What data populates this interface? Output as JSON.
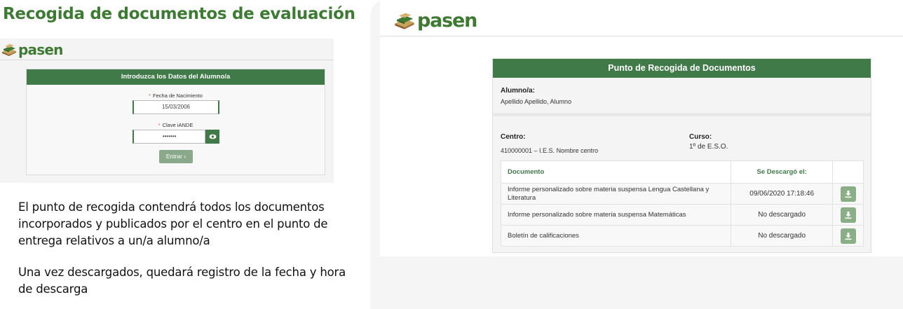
{
  "slide_title": "Recogida de documentos de evaluación",
  "brand": {
    "name": "pasen",
    "color": "#3f7a33",
    "accent": "#3f7a48"
  },
  "login_form": {
    "header": "Introduzca los Datos del Alumno/a",
    "birthdate_label": "Fecha de Nacimiento",
    "birthdate_value": "15/03/2006",
    "key_label": "Clave iANDE",
    "key_value": "•••••••",
    "submit_label": "Entrar ›",
    "required_mark": "*"
  },
  "paragraphs": [
    "El punto de recogida contendrá todos los documentos incorporados y publicados por el centro en el punto de entrega relativos a un/a alumno/a",
    "Una vez descargados, quedará registro de la fecha y hora de descarga"
  ],
  "collection_point": {
    "header": "Punto de Recogida de Documentos",
    "student_label": "Alumno/a:",
    "student_value": "Apellido Apellido, Alumno",
    "center_label": "Centro:",
    "center_value": "410000001 – I.E.S. Nombre centro",
    "course_label": "Curso:",
    "course_value": "1º de E.S.O.",
    "table": {
      "columns": [
        "Documento",
        "Se Descargó el:",
        ""
      ],
      "rows": [
        {
          "document": "Informe personalizado sobre materia suspensa Lengua Castellana y Literatura",
          "downloaded": "09/06/2020 17:18:46",
          "action_icon": "download-icon"
        },
        {
          "document": "Informe personalizado sobre materia suspensa Matemáticas",
          "downloaded": "No descargado",
          "action_icon": "download-icon"
        },
        {
          "document": "Boletín de calificaciones",
          "downloaded": "No descargado",
          "action_icon": "download-icon"
        }
      ]
    }
  }
}
